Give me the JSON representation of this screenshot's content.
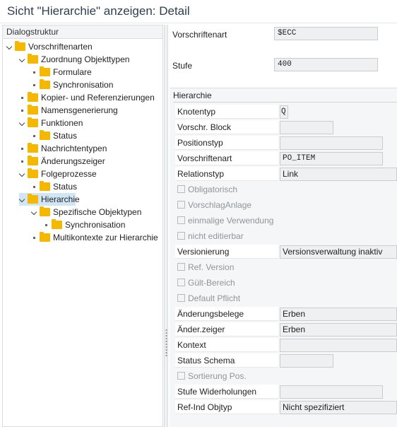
{
  "window": {
    "title": "Sicht \"Hierarchie\" anzeigen: Detail"
  },
  "tree": {
    "header": "Dialogstruktur",
    "items": [
      {
        "label": "Vorschriftenarten",
        "toggle": "exp"
      },
      {
        "label": "Zuordnung Objekttypen",
        "toggle": "exp"
      },
      {
        "label": "Formulare",
        "toggle": "dot"
      },
      {
        "label": "Synchronisation",
        "toggle": "dot"
      },
      {
        "label": "Kopier- und Referenzierungen",
        "toggle": "dot"
      },
      {
        "label": "Namensgenerierung",
        "toggle": "dot"
      },
      {
        "label": "Funktionen",
        "toggle": "exp"
      },
      {
        "label": "Status",
        "toggle": "dot"
      },
      {
        "label": "Nachrichtentypen",
        "toggle": "dot"
      },
      {
        "label": "Änderungszeiger",
        "toggle": "dot"
      },
      {
        "label": "Folgeprozesse",
        "toggle": "exp"
      },
      {
        "label": "Status",
        "toggle": "dot"
      },
      {
        "label": "Hierarchie",
        "toggle": "exp",
        "selected": true
      },
      {
        "label": "Spezifische Objektypen",
        "toggle": "exp"
      },
      {
        "label": "Synchronisation",
        "toggle": "dot"
      },
      {
        "label": "Multikontexte zur Hierarchie",
        "toggle": "dot"
      }
    ]
  },
  "header_fields": {
    "vorschriftenart_label": "Vorschriftenart",
    "vorschriftenart_value": "$ECC",
    "stufe_label": "Stufe",
    "stufe_value": "400"
  },
  "hierarchie": {
    "title": "Hierarchie",
    "knotentyp_label": "Knotentyp",
    "knotentyp_value": "Q",
    "vorschr_block_label": "Vorschr. Block",
    "vorschr_block_value": "",
    "positionstyp_label": "Positionstyp",
    "positionstyp_value": "",
    "vorschriftenart_label": "Vorschriftenart",
    "vorschriftenart_value": "PO_ITEM",
    "relationstyp_label": "Relationstyp",
    "relationstyp_value": "Link",
    "obligatorisch_label": "Obligatorisch",
    "vorschlaganlage_label": "VorschlagAnlage",
    "einmalige_label": "einmalige Verwendung",
    "nicht_editierbar_label": "nicht editierbar",
    "versionierung_label": "Versionierung",
    "versionierung_value": "Versionsverwaltung inaktiv",
    "ref_version_label": "Ref. Version",
    "guelt_bereich_label": "Gült-Bereich",
    "default_pflicht_label": "Default Pflicht",
    "aenderungsbelege_label": "Änderungsbelege",
    "aenderungsbelege_value": "Erben",
    "aender_zeiger_label": "Änder.zeiger",
    "aender_zeiger_value": "Erben",
    "kontext_label": "Kontext",
    "kontext_value": "",
    "status_schema_label": "Status Schema",
    "status_schema_value": "",
    "sortierung_label": "Sortierung Pos.",
    "stufe_wdh_label": "Stufe Widerholungen",
    "stufe_wdh_value": "",
    "ref_ind_label": "Ref-Ind Objtyp",
    "ref_ind_value": "Nicht spezifiziert"
  },
  "colors": {
    "folder": "#f5b800",
    "selection": "#d1e6f5",
    "readonly_field": "#eef0f2"
  }
}
